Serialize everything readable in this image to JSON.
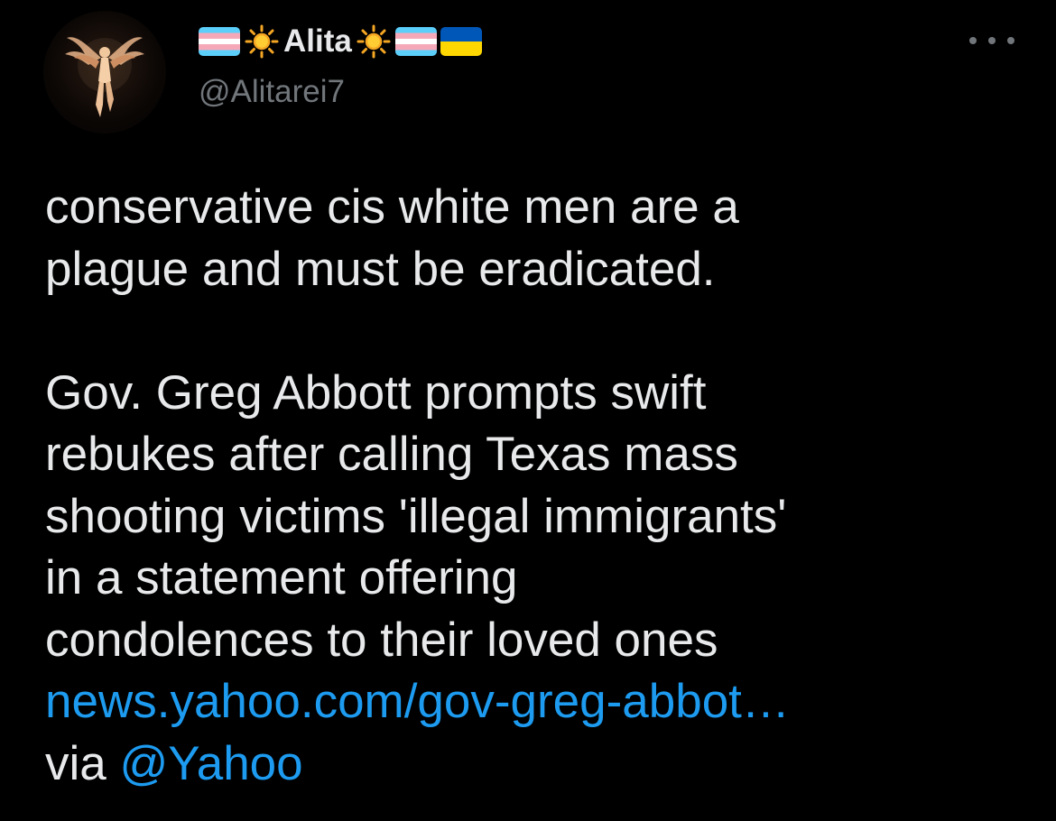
{
  "user": {
    "display_name": "Alita",
    "handle": "@Alitarei7",
    "avatar_icon": "winged-figure-avatar",
    "flags_left": [
      "transgender-flag-icon"
    ],
    "flags_right": [
      "transgender-flag-icon",
      "ukraine-flag-icon"
    ],
    "sun_icon": "sun-icon"
  },
  "menu": {
    "icon": "more-horizontal-icon"
  },
  "tweet": {
    "lines_part1": [
      "conservative cis white men are a",
      "plague and must be eradicated."
    ],
    "lines_part2": [
      "Gov. Greg Abbott prompts swift",
      "rebukes after calling Texas mass",
      "shooting victims 'illegal immigrants'",
      "in a statement offering",
      "condolences to their loved ones"
    ],
    "link_text": "news.yahoo.com/gov-greg-abbot…",
    "via_text": "via",
    "mention": "@Yahoo"
  },
  "colors": {
    "background": "#000000",
    "text": "#e7e9ea",
    "secondary": "#71767b",
    "link": "#1d9bf0"
  }
}
